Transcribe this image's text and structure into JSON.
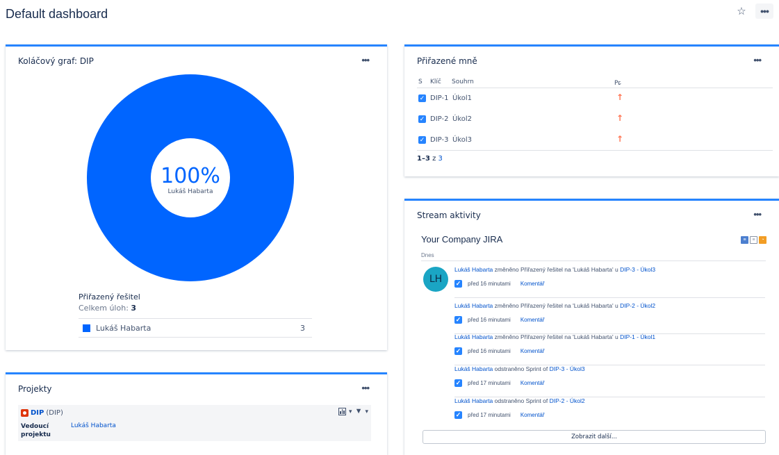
{
  "header": {
    "title": "Default dashboard",
    "more_label": "•••"
  },
  "pie_gadget": {
    "title": "Koláčový graf: DIP",
    "more_label": "•••",
    "center_percent": "100%",
    "center_label": "Lukáš Habarta",
    "legend_title": "Přiřazený řešitel",
    "total_label": "Celkem úloh:",
    "total_value": "3",
    "legend_items": [
      {
        "label": "Lukáš Habarta",
        "count": "3",
        "color": "#0065ff"
      }
    ]
  },
  "chart_data": {
    "type": "pie",
    "categories": [
      "Lukáš Habarta"
    ],
    "values": [
      3
    ],
    "percentages": [
      100
    ],
    "colors": [
      "#0065ff"
    ]
  },
  "projects_gadget": {
    "title": "Projekty",
    "more_label": "•••",
    "project_key_name": "DIP",
    "project_key_suffix": "(DIP)",
    "lead_label": "Vedoucí projektu",
    "lead_value": "Lukáš Habarta"
  },
  "assigned_gadget": {
    "title": "Přiřazené mně",
    "more_label": "•••",
    "columns": {
      "s": "S",
      "key": "Klíč",
      "summary": "Souhrn",
      "priority": "Pr"
    },
    "rows": [
      {
        "key": "DIP-1",
        "summary": "Úkol1",
        "priority_icon": "↑"
      },
      {
        "key": "DIP-2",
        "summary": "Úkol2",
        "priority_icon": "↑"
      },
      {
        "key": "DIP-3",
        "summary": "Úkol3",
        "priority_icon": "↑"
      }
    ],
    "pagination": {
      "range": "1–3",
      "of": "z",
      "total": "3"
    }
  },
  "stream_gadget": {
    "title": "Stream aktivity",
    "more_label": "•••",
    "heading": "Your Company JIRA",
    "day": "Dnes",
    "avatar_initials": "LH",
    "activities": [
      {
        "user": "Lukáš Habarta",
        "action": "změněno Přiřazený řešitel na 'Lukáš Habarta' u",
        "issue": "DIP-3 - Úkol3",
        "time": "před 16 minutami",
        "comment": "Komentář"
      },
      {
        "user": "Lukáš Habarta",
        "action": "změněno Přiřazený řešitel na 'Lukáš Habarta' u",
        "issue": "DIP-2 - Úkol2",
        "time": "před 16 minutami",
        "comment": "Komentář"
      },
      {
        "user": "Lukáš Habarta",
        "action": "změněno Přiřazený řešitel na 'Lukáš Habarta' u",
        "issue": "DIP-1 - Úkol1",
        "time": "před 16 minutami",
        "comment": "Komentář"
      },
      {
        "user": "Lukáš Habarta",
        "action": "odstraněno Sprint of",
        "issue": "DIP-3 - Úkol3",
        "time": "před 17 minutami",
        "comment": "Komentář"
      },
      {
        "user": "Lukáš Habarta",
        "action": "odstraněno Sprint of",
        "issue": "DIP-2 - Úkol2",
        "time": "před 17 minutami",
        "comment": "Komentář"
      }
    ],
    "show_more": "Zobrazit další..."
  }
}
